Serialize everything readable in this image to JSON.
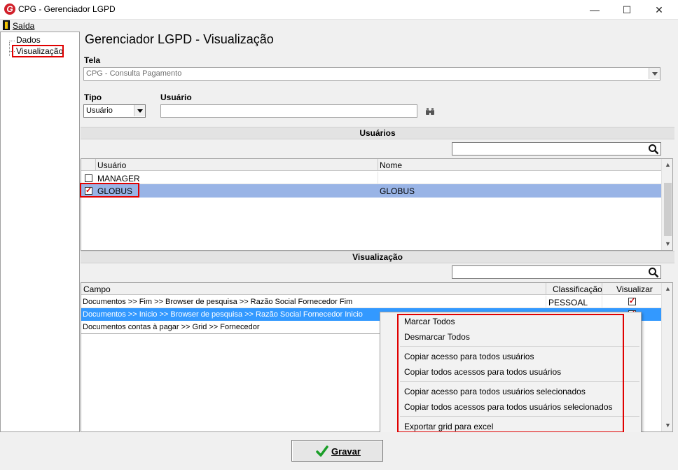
{
  "window": {
    "title": "CPG - Gerenciador LGPD",
    "logo_letter": "G",
    "minimize": "—",
    "maximize": "☐",
    "close": "✕"
  },
  "menu": {
    "saida": "Saída"
  },
  "tree": {
    "items": [
      {
        "label": "Dados"
      },
      {
        "label": "Visualização"
      }
    ]
  },
  "main": {
    "title": "Gerenciador LGPD - Visualização",
    "tela_label": "Tela",
    "tela_value": "CPG - Consulta Pagamento",
    "tipo_label": "Tipo",
    "tipo_value": "Usuário",
    "usuario_label": "Usuário",
    "usuario_value": ""
  },
  "usuarios": {
    "header": "Usuários",
    "search_value": "",
    "columns": [
      "Usuário",
      "Nome"
    ],
    "rows": [
      {
        "checked": false,
        "usuario": "MANAGER",
        "nome": ""
      },
      {
        "checked": true,
        "usuario": "GLOBUS",
        "nome": "GLOBUS"
      }
    ]
  },
  "visualizacao": {
    "header": "Visualização",
    "search_value": "",
    "columns": [
      "Campo",
      "Classificação",
      "Visualizar"
    ],
    "rows": [
      {
        "campo": "Documentos >> Fim >> Browser de pesquisa >> Razão Social Fornecedor Fim",
        "classificacao": "PESSOAL",
        "visualizar": true
      },
      {
        "campo": "Documentos >> Inicio >> Browser de pesquisa >> Razão Social Fornecedor Inicio",
        "classificacao": "",
        "visualizar": true
      },
      {
        "campo": "Documentos contas à pagar >> Grid >> Fornecedor",
        "classificacao": "",
        "visualizar": false
      }
    ]
  },
  "context_menu": {
    "items": [
      "Marcar Todos",
      "Desmarcar Todos",
      "Copiar acesso para todos usuários",
      "Copiar todos acessos para todos usuários",
      "Copiar acesso para todos usuários selecionados",
      "Copiar todos acessos para todos usuários selecionados",
      "Exportar grid para excel"
    ]
  },
  "footer": {
    "gravar": "Gravar"
  },
  "colors": {
    "selected_row": "#99b4e6",
    "highlight_row": "#3399ff",
    "annotation_red": "#e00000",
    "check_red": "#d40000",
    "gravar_check": "#1a9e28"
  }
}
